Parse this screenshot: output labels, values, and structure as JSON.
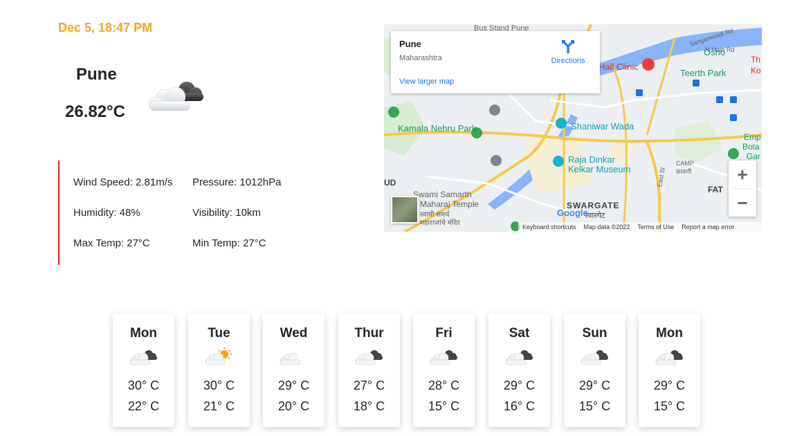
{
  "header": {
    "datetime": "Dec 5, 18:47 PM"
  },
  "current": {
    "city": "Pune",
    "temperature": "26.82°C",
    "icon": "cloudy-icon"
  },
  "details": {
    "wind": "Wind Speed: 2.81m/s",
    "pressure": "Pressure: 1012hPa",
    "humidity": "Humidity: 48%",
    "visibility": "Visibility: 10km",
    "max_temp": "Max Temp: 27°C",
    "min_temp": "Min Temp: 27°C"
  },
  "map": {
    "place_title": "Pune",
    "place_sub": "Maharashtra",
    "larger_map_link": "View larger map",
    "directions_label": "Directions",
    "zoom_in": "+",
    "zoom_out": "−",
    "labels": {
      "shaniwar": "Shaniwar Wada",
      "kamala": "Kamala Nehru Park",
      "raja1": "Raja Dinkar",
      "raja2": "Kelkar Museum",
      "swami1": "Swami Samarth",
      "swami2": "Maharaj Temple",
      "swami3": "स्वामी समर्थ",
      "swami4": "महाराजांचे मंदिर",
      "swargate": "SWARGATE",
      "swargate_mr": "स्वारगेट",
      "osho1": "Osho",
      "osho2": "Teerth Park",
      "hall_clinic": "Hall Clinic",
      "camp": "CAMP",
      "camp_mr": "छावणी",
      "east_st": "East St",
      "n_main": "N Main Rd",
      "sangamwadi": "Sangamwadi Rd",
      "bus_stand": "Bus Stand Pune",
      "fat": "FAT",
      "ud": "UD",
      "emp1": "Emp",
      "emp2": "Bota",
      "emp3": "Gar",
      "th1": "Th",
      "th2": "Ko"
    },
    "footer": {
      "shortcuts": "Keyboard shortcuts",
      "data": "Map data ©2022",
      "terms": "Terms of Use",
      "report": "Report a map error"
    },
    "google": "Google"
  },
  "forecast": [
    {
      "day": "Mon",
      "icon": "cloudy-icon",
      "max": "30° C",
      "min": "22° C"
    },
    {
      "day": "Tue",
      "icon": "partly-sunny-icon",
      "max": "30° C",
      "min": "21° C"
    },
    {
      "day": "Wed",
      "icon": "light-cloud-icon",
      "max": "29° C",
      "min": "20° C"
    },
    {
      "day": "Thur",
      "icon": "cloudy-icon",
      "max": "27° C",
      "min": "18° C"
    },
    {
      "day": "Fri",
      "icon": "cloudy-icon",
      "max": "28° C",
      "min": "15° C"
    },
    {
      "day": "Sat",
      "icon": "cloudy-icon",
      "max": "29° C",
      "min": "16° C"
    },
    {
      "day": "Sun",
      "icon": "cloudy-icon",
      "max": "29° C",
      "min": "15° C"
    },
    {
      "day": "Mon",
      "icon": "cloudy-icon",
      "max": "29° C",
      "min": "15° C"
    }
  ],
  "colors": {
    "accent": "#f5a623",
    "divider": "#e02020",
    "link": "#1a73e8"
  }
}
